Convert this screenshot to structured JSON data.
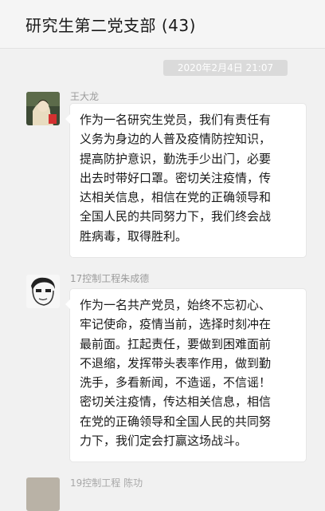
{
  "chat": {
    "title": "研究生第二党支部 (43)",
    "timestamp": "2020年2月4日 21:07"
  },
  "messages": [
    {
      "sender": "王大龙",
      "avatar": "photo-avatar",
      "text": "作为一名研究生党员，我们有责任有\n义务为身边的人普及疫情防控知识，\n提高防护意识，勤洗手少出门，必要\n出去时带好口罩。密切关注疫情，传\n达相关信息，相信在党的正确领导和\n全国人民的共同努力下，我们终会战\n胜病毒，取得胜利。"
    },
    {
      "sender": "17控制工程朱成德",
      "avatar": "cartoon-face-avatar",
      "text": "作为一名共产党员，始终不忘初心、\n牢记使命，疫情当前，选择时刻冲在\n最前面。扛起责任，要做到困难面前\n不退缩，发挥带头表率作用，做到勤\n洗手，多看新闻，不造谣，不信谣！\n密切关注疫情，传达相关信息，相信\n在党的正确领导和全国人民的共同努\n力下，我们定会打赢这场战斗。"
    },
    {
      "sender": "19控制工程 陈功",
      "avatar": "partial-avatar"
    }
  ]
}
